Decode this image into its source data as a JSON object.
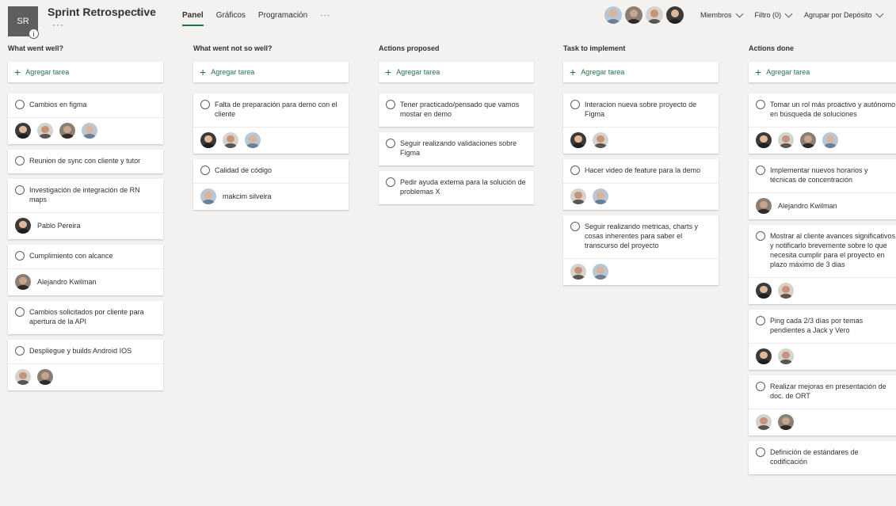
{
  "header": {
    "logo_initials": "SR",
    "info_badge": "i",
    "title": "Sprint Retrospective",
    "star": "☆",
    "more": "···",
    "tabs": [
      {
        "label": "Panel",
        "active": true
      },
      {
        "label": "Gráficos",
        "active": false
      },
      {
        "label": "Programación",
        "active": false
      }
    ],
    "tabs_more": "···",
    "controls": {
      "members": "Miembros",
      "filter": "Filtro (0)",
      "group": "Agrupar por Depósito"
    }
  },
  "colors": {
    "accent": "#217346",
    "background": "#f3f2f1",
    "card": "#ffffff"
  },
  "board": {
    "add_label": "Agregar tarea",
    "columns": [
      {
        "title": "What went well?",
        "cards": [
          {
            "title": "Cambios en figma",
            "footer": {
              "avatars": [
                "a1",
                "a2",
                "a3",
                "a4"
              ]
            }
          },
          {
            "title": "Reunion de sync con cliente y tutor"
          },
          {
            "title": "Investigación de integración de RN maps",
            "footer": {
              "avatars": [
                "a1"
              ],
              "name": "Pablo Pereira"
            }
          },
          {
            "title": "Cumplimiento con alcance",
            "footer": {
              "avatars": [
                "a3"
              ],
              "name": "Alejandro Kwilman"
            }
          },
          {
            "title": "Cambios solicitados por cliente para apertura de la API"
          },
          {
            "title": "Despliegue y builds Android IOS",
            "footer": {
              "avatars": [
                "a2",
                "a3"
              ]
            }
          }
        ]
      },
      {
        "title": "What went not so well?",
        "cards": [
          {
            "title": "Falta de preparación para demo con el cliente",
            "footer": {
              "avatars": [
                "a1",
                "a2",
                "a4"
              ]
            }
          },
          {
            "title": "Calidad de código",
            "footer": {
              "avatars": [
                "a4"
              ],
              "name": "makcim silveira"
            }
          }
        ]
      },
      {
        "title": "Actions proposed",
        "cards": [
          {
            "title": "Tener practicado/pensado que vamos mostar en demo"
          },
          {
            "title": "Seguir realizando validaciones sobre Figma"
          },
          {
            "title": "Pedir ayuda externa para la solución de problemas X"
          }
        ]
      },
      {
        "title": "Task to implement",
        "cards": [
          {
            "title": "Interacion nueva sobre proyecto de Figma",
            "footer": {
              "avatars": [
                "a1",
                "a2"
              ]
            }
          },
          {
            "title": "Hacer video de feature para la demo",
            "footer": {
              "avatars": [
                "a2",
                "a4"
              ]
            }
          },
          {
            "title": "Seguir realizando metricas, charts y cosas inherentes para saber el transcurso del proyecto",
            "footer": {
              "avatars": [
                "a2",
                "a4"
              ]
            }
          }
        ]
      },
      {
        "title": "Actions done",
        "cards": [
          {
            "title": "Tomar un rol más proactivo y autónomo en búsqueda de soluciones",
            "footer": {
              "avatars": [
                "a1",
                "a2",
                "a3",
                "a4"
              ]
            }
          },
          {
            "title": "Implementar nuevos horarios y técnicas de concentración",
            "footer": {
              "avatars": [
                "a3"
              ],
              "name": "Alejandro Kwilman"
            }
          },
          {
            "title": "Mostrar al cliente avances significativos y notificarlo brevemente sobre lo que necesita cumplir para el proyecto en plazo máximo de 3 dias",
            "footer": {
              "avatars": [
                "a1",
                "a2"
              ]
            }
          },
          {
            "title": "Ping cada 2/3 días por temas pendientes a Jack y Vero",
            "footer": {
              "avatars": [
                "a1",
                "a2"
              ]
            }
          },
          {
            "title": "Realizar mejoras en presentación de doc. de ORT",
            "footer": {
              "avatars": [
                "a2",
                "a3"
              ]
            }
          },
          {
            "title": "Definición de estándares de codificación"
          }
        ]
      }
    ]
  },
  "members_avatars": [
    "a4",
    "a3",
    "a2",
    "a1"
  ]
}
